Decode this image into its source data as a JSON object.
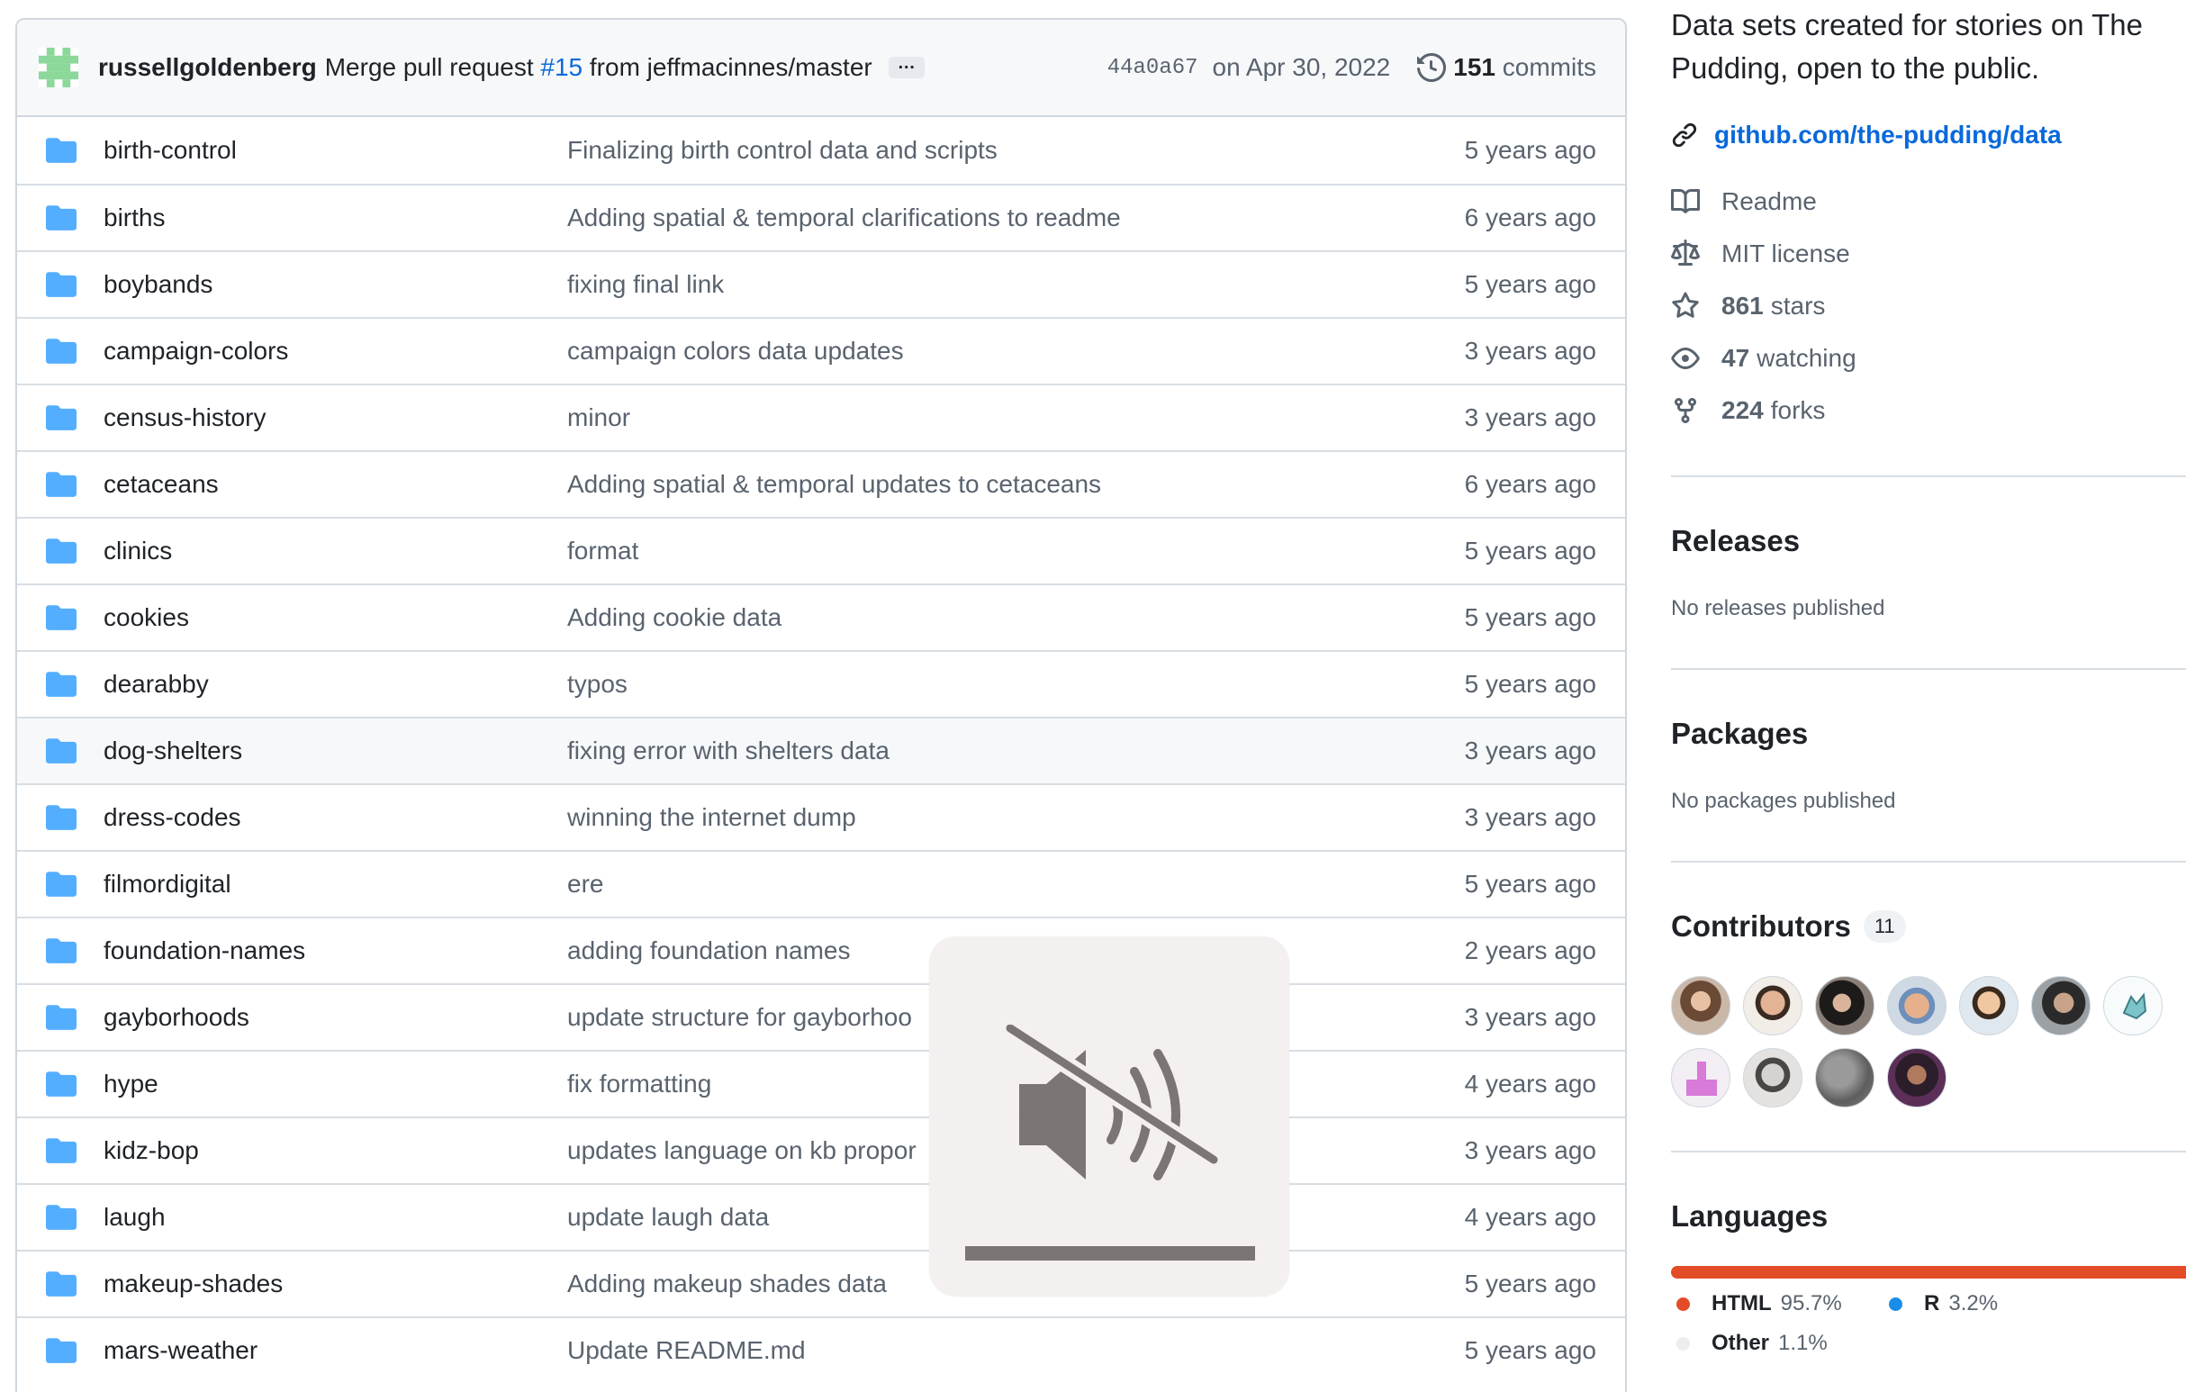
{
  "commit": {
    "author": "russellgoldenberg",
    "message_prefix": "Merge pull request",
    "pr_link": "#15",
    "message_suffix": "from jeffmacinnes/master",
    "ellipsis": "…",
    "sha": "44a0a67",
    "date": "on Apr 30, 2022",
    "count": "151",
    "count_label": "commits"
  },
  "files": [
    {
      "name": "birth-control",
      "message": "Finalizing birth control data and scripts",
      "age": "5 years ago"
    },
    {
      "name": "births",
      "message": "Adding spatial & temporal clarifications to readme",
      "age": "6 years ago"
    },
    {
      "name": "boybands",
      "message": "fixing final link",
      "age": "5 years ago"
    },
    {
      "name": "campaign-colors",
      "message": "campaign colors data updates",
      "age": "3 years ago"
    },
    {
      "name": "census-history",
      "message": "minor",
      "age": "3 years ago"
    },
    {
      "name": "cetaceans",
      "message": "Adding spatial & temporal updates to cetaceans",
      "age": "6 years ago"
    },
    {
      "name": "clinics",
      "message": "format",
      "age": "5 years ago"
    },
    {
      "name": "cookies",
      "message": "Adding cookie data",
      "age": "5 years ago"
    },
    {
      "name": "dearabby",
      "message": "typos",
      "age": "5 years ago"
    },
    {
      "name": "dog-shelters",
      "message": "fixing error with shelters data",
      "age": "3 years ago"
    },
    {
      "name": "dress-codes",
      "message": "winning the internet dump",
      "age": "3 years ago"
    },
    {
      "name": "filmordigital",
      "message": "ere",
      "age": "5 years ago"
    },
    {
      "name": "foundation-names",
      "message": "adding foundation names",
      "age": "2 years ago"
    },
    {
      "name": "gayborhoods",
      "message": "update structure for gayborhoo",
      "age": "3 years ago"
    },
    {
      "name": "hype",
      "message": "fix formatting",
      "age": "4 years ago"
    },
    {
      "name": "kidz-bop",
      "message": "updates language on kb propor",
      "age": "3 years ago"
    },
    {
      "name": "laugh",
      "message": "update laugh data",
      "age": "4 years ago"
    },
    {
      "name": "makeup-shades",
      "message": "Adding makeup shades data",
      "age": "5 years ago"
    },
    {
      "name": "mars-weather",
      "message": "Update README.md",
      "age": "5 years ago"
    }
  ],
  "about": {
    "description": "Data sets created for stories on The Pudding, open to the public.",
    "link": "github.com/the-pudding/data",
    "readme": "Readme",
    "license": "MIT license",
    "stars_count": "861",
    "stars_label": "stars",
    "watching_count": "47",
    "watching_label": "watching",
    "forks_count": "224",
    "forks_label": "forks"
  },
  "releases": {
    "title": "Releases",
    "subtitle": "No releases published"
  },
  "packages": {
    "title": "Packages",
    "subtitle": "No packages published"
  },
  "contributors": {
    "title": "Contributors",
    "count": "11"
  },
  "languages": {
    "title": "Languages",
    "items": [
      {
        "name": "HTML",
        "percent": "95.7%",
        "value": 95.7,
        "color": "#e34c26"
      },
      {
        "name": "R",
        "percent": "3.2%",
        "value": 3.2,
        "color": "#198ce7"
      },
      {
        "name": "Other",
        "percent": "1.1%",
        "value": 1.1,
        "color": "#ededed"
      }
    ]
  },
  "colors": {
    "link": "#0969da",
    "folder": "#54aeff",
    "border": "#d0d7de"
  }
}
